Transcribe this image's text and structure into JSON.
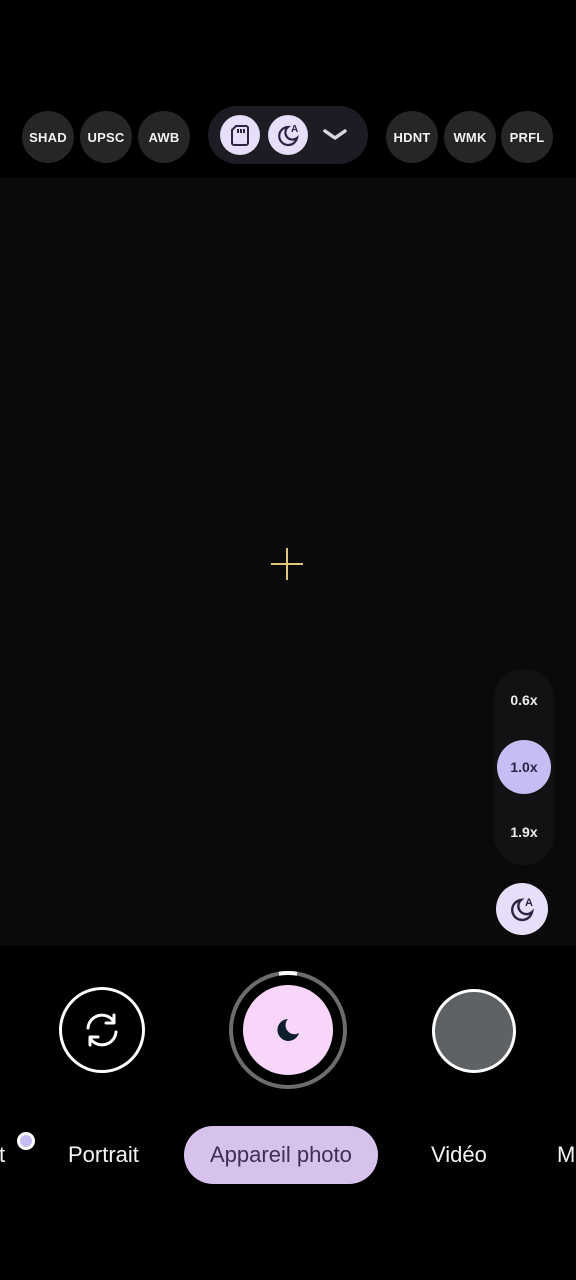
{
  "top_bar": {
    "left_buttons": [
      "SHAD",
      "UPSC",
      "AWB"
    ],
    "right_buttons": [
      "HDNT",
      "WMK",
      "PRFL"
    ],
    "pill_icons": [
      "sd-card-icon",
      "night-auto-icon",
      "chevron-down-icon"
    ]
  },
  "zoom": {
    "options": [
      "0.6x",
      "1.0x",
      "1.9x"
    ],
    "selected": "1.0x"
  },
  "modes": {
    "partial_left": "t",
    "items": [
      "Portrait",
      "Appareil photo",
      "Vidéo"
    ],
    "partial_right": "M",
    "active": "Appareil photo"
  },
  "colors": {
    "accent": "#c8bdf3",
    "shutter": "#f8d6fa",
    "active_mode": "#d7c2ed",
    "focus_indicator": "#e2c47a"
  }
}
